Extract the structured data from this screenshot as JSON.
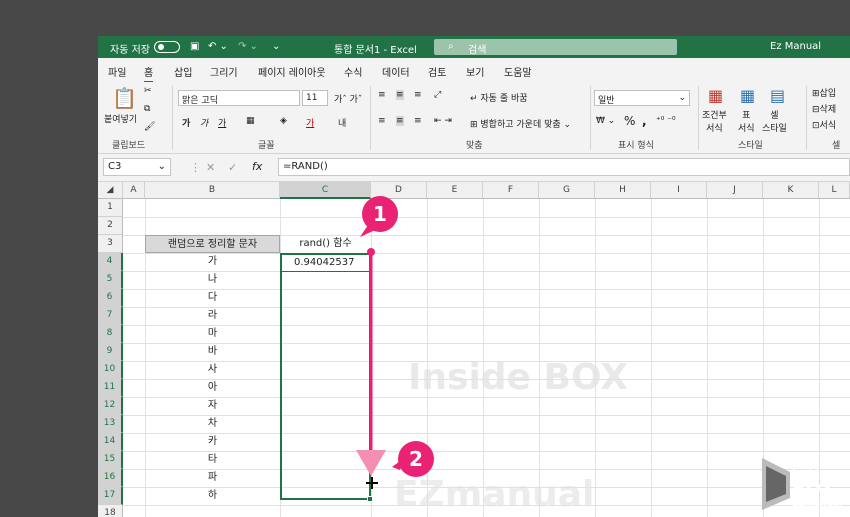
{
  "titlebar": {
    "autosave_label": "자동 저장",
    "autosave_state": "끔",
    "doc_title": "통합 문서1 - Excel",
    "search_placeholder": "검색",
    "user": "Ez Manual"
  },
  "menu": [
    "파일",
    "홈",
    "삽입",
    "그리기",
    "페이지 레이아웃",
    "수식",
    "데이터",
    "검토",
    "보기",
    "도움말"
  ],
  "ribbon": {
    "clipboard": {
      "paste_label": "붙여넣기",
      "group_label": "클립보드"
    },
    "font": {
      "font_name": "맑은 고딕",
      "font_size": "11",
      "group_label": "글꼴"
    },
    "align": {
      "wrap_text": "자동 줄 바꿈",
      "merge_center": "병합하고 가운데 맞춤",
      "group_label": "맞춤"
    },
    "number": {
      "format": "일반",
      "group_label": "표시 형식"
    },
    "styles": {
      "conditional": "조건부\n서식",
      "table": "표\n서식",
      "cell_style": "셀\n스타일",
      "group_label": "스타일"
    },
    "cells": {
      "insert": "삽입",
      "delete": "삭제",
      "format": "서식",
      "group_label": "셀"
    }
  },
  "formula_bar": {
    "name_box": "C3",
    "formula": "=RAND()"
  },
  "sheet": {
    "columns": [
      "A",
      "B",
      "C",
      "D",
      "E",
      "F",
      "G",
      "H",
      "I",
      "J",
      "K",
      "L"
    ],
    "rows": [
      "1",
      "2",
      "3",
      "4",
      "5",
      "6",
      "7",
      "8",
      "9",
      "10",
      "11",
      "12",
      "13",
      "14",
      "15",
      "16",
      "17",
      "18"
    ],
    "header_b": "랜덤으로 정리할 문자",
    "header_c": "rand() 함수",
    "c3_value": "0.94042537",
    "b_values": [
      "가",
      "나",
      "다",
      "라",
      "마",
      "바",
      "사",
      "아",
      "자",
      "차",
      "카",
      "타",
      "파",
      "하"
    ]
  },
  "callouts": [
    "1",
    "2"
  ],
  "colors": {
    "excel_green": "#217346",
    "accent_pink": "#e92273"
  }
}
